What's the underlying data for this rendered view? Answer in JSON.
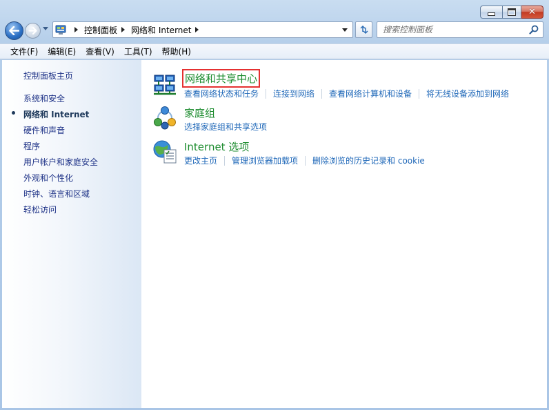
{
  "window": {
    "caption": {
      "minimize": "–",
      "maximize": "□",
      "close": "✕"
    }
  },
  "navigation": {
    "back_icon": "back-arrow-icon",
    "forward_icon": "forward-arrow-icon",
    "address": {
      "icon": "control-panel-icon",
      "crumbs": [
        "控制面板",
        "网络和 Internet"
      ]
    },
    "refresh_icon": "refresh-icon",
    "search": {
      "placeholder": "搜索控制面板",
      "value": "",
      "icon": "search-icon"
    }
  },
  "menu": {
    "items": [
      "文件(F)",
      "编辑(E)",
      "查看(V)",
      "工具(T)",
      "帮助(H)"
    ]
  },
  "sidebar": {
    "home": "控制面板主页",
    "items": [
      {
        "label": "系统和安全",
        "active": false
      },
      {
        "label": "网络和 Internet",
        "active": true
      },
      {
        "label": "硬件和声音",
        "active": false
      },
      {
        "label": "程序",
        "active": false
      },
      {
        "label": "用户帐户和家庭安全",
        "active": false
      },
      {
        "label": "外观和个性化",
        "active": false
      },
      {
        "label": "时钟、语言和区域",
        "active": false
      },
      {
        "label": "轻松访问",
        "active": false
      }
    ]
  },
  "categories": [
    {
      "title": "网络和共享中心",
      "highlighted": true,
      "icon": "network-sharing-center-icon",
      "links": [
        "查看网络状态和任务",
        "连接到网络",
        "查看网络计算机和设备",
        "将无线设备添加到网络"
      ]
    },
    {
      "title": "家庭组",
      "highlighted": false,
      "icon": "homegroup-icon",
      "links": [
        "选择家庭组和共享选项"
      ]
    },
    {
      "title": "Internet 选项",
      "highlighted": false,
      "icon": "internet-options-icon",
      "links": [
        "更改主页",
        "管理浏览器加载项",
        "删除浏览的历史记录和 cookie"
      ]
    }
  ],
  "colors": {
    "category_title": "#1b8b2d",
    "link": "#1e67b8",
    "highlight_box": "#e53030"
  }
}
